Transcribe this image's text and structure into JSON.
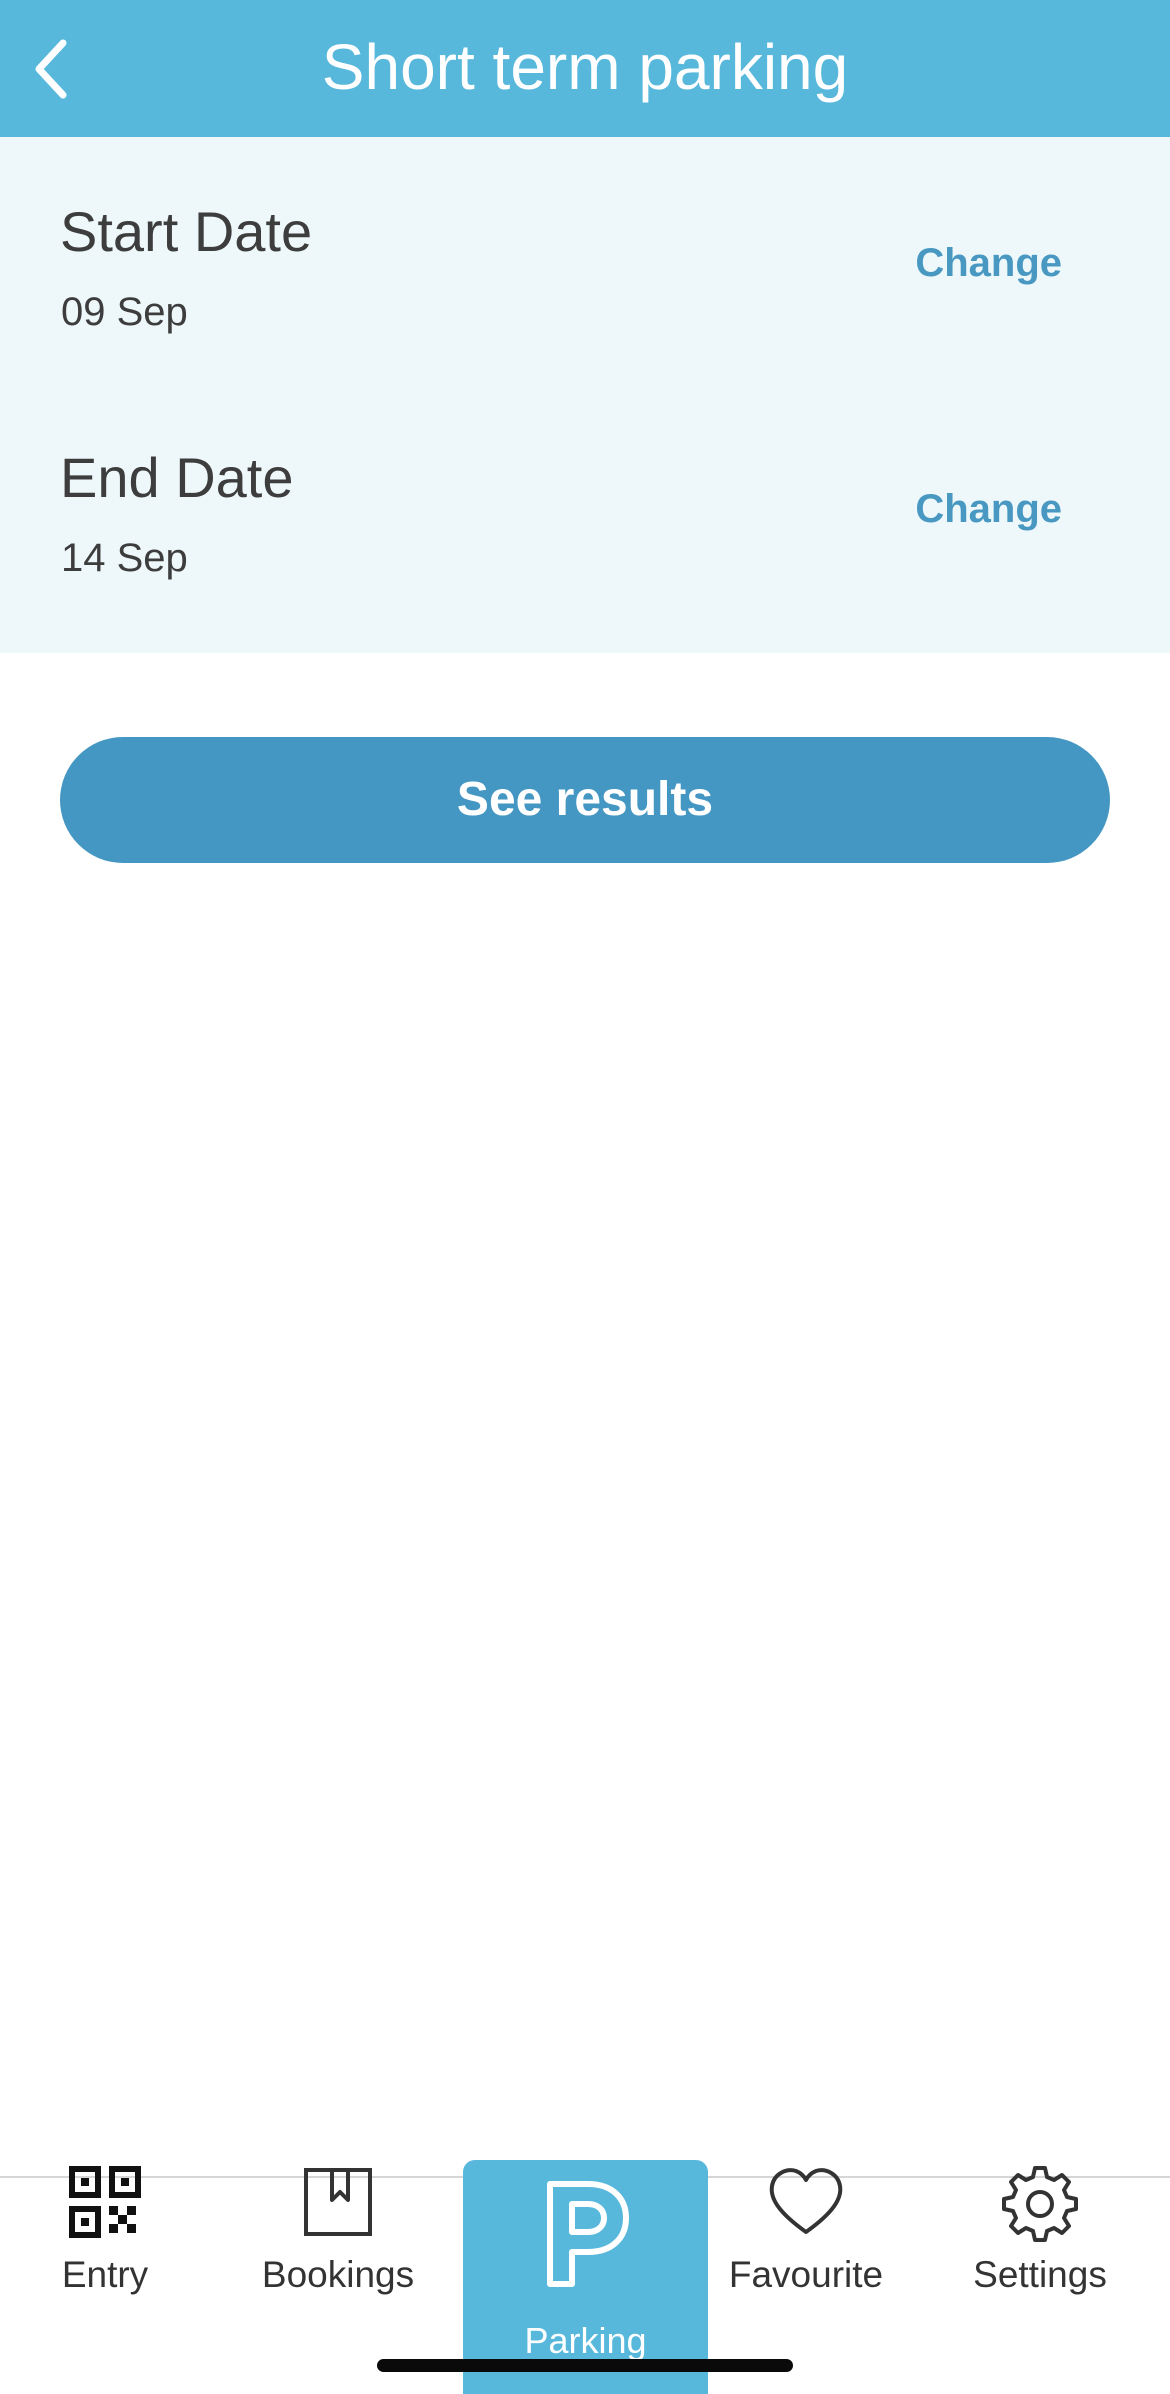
{
  "header": {
    "title": "Short term parking"
  },
  "dates": {
    "start": {
      "label": "Start Date",
      "value": "09 Sep",
      "action": "Change"
    },
    "end": {
      "label": "End Date",
      "value": "14 Sep",
      "action": "Change"
    }
  },
  "results_button": "See results",
  "tabbar": {
    "tabs": [
      {
        "label": "Entry",
        "icon": "qr-code-icon",
        "active": false
      },
      {
        "label": "Bookings",
        "icon": "bookmark-icon",
        "active": false
      },
      {
        "label": "Parking",
        "icon": "parking-icon",
        "active": true
      },
      {
        "label": "Favourite",
        "icon": "heart-icon",
        "active": false
      },
      {
        "label": "Settings",
        "icon": "gear-icon",
        "active": false
      }
    ]
  },
  "colors": {
    "header": "#58b8dc",
    "button": "#4597c3",
    "link": "#4898c2",
    "dates_bg": "#eef8fa"
  }
}
